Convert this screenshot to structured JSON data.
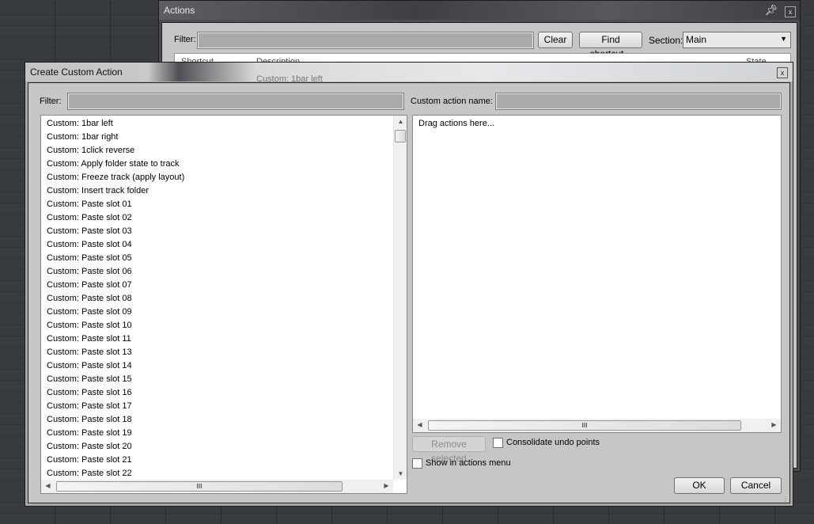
{
  "actions_window": {
    "title": "Actions",
    "filter_label": "Filter:",
    "filter_value": "",
    "clear_label": "Clear",
    "find_shortcut_label": "Find shortcut...",
    "section_label": "Section:",
    "section_value": "Main",
    "columns": [
      "Shortcut",
      "Description",
      "State"
    ],
    "first_row": "Custom: 1bar left"
  },
  "dialog": {
    "title": "Create Custom Action",
    "filter_label": "Filter:",
    "filter_value": "",
    "name_label": "Custom action name:",
    "name_value": "",
    "items": [
      "Custom: 1bar left",
      "Custom: 1bar right",
      "Custom: 1click reverse",
      "Custom: Apply folder state to track",
      "Custom: Freeze track (apply layout)",
      "Custom: Insert track folder",
      "Custom: Paste slot 01",
      "Custom: Paste slot 02",
      "Custom: Paste slot 03",
      "Custom: Paste slot 04",
      "Custom: Paste slot 05",
      "Custom: Paste slot 06",
      "Custom: Paste slot 07",
      "Custom: Paste slot 08",
      "Custom: Paste slot 09",
      "Custom: Paste slot 10",
      "Custom: Paste slot 11",
      "Custom: Paste slot 13",
      "Custom: Paste slot 14",
      "Custom: Paste slot 15",
      "Custom: Paste slot 16",
      "Custom: Paste slot 17",
      "Custom: Paste slot 18",
      "Custom: Paste slot 19",
      "Custom: Paste slot 20",
      "Custom: Paste slot 21",
      "Custom: Paste slot 22"
    ],
    "drop_hint": "Drag actions here...",
    "remove_selected": "Remove selected",
    "consolidate_label": "Consolidate undo points",
    "consolidate_checked": false,
    "show_in_menu_label": "Show in actions menu",
    "show_in_menu_checked": false,
    "ok": "OK",
    "cancel": "Cancel",
    "scroll_grip": "III"
  }
}
